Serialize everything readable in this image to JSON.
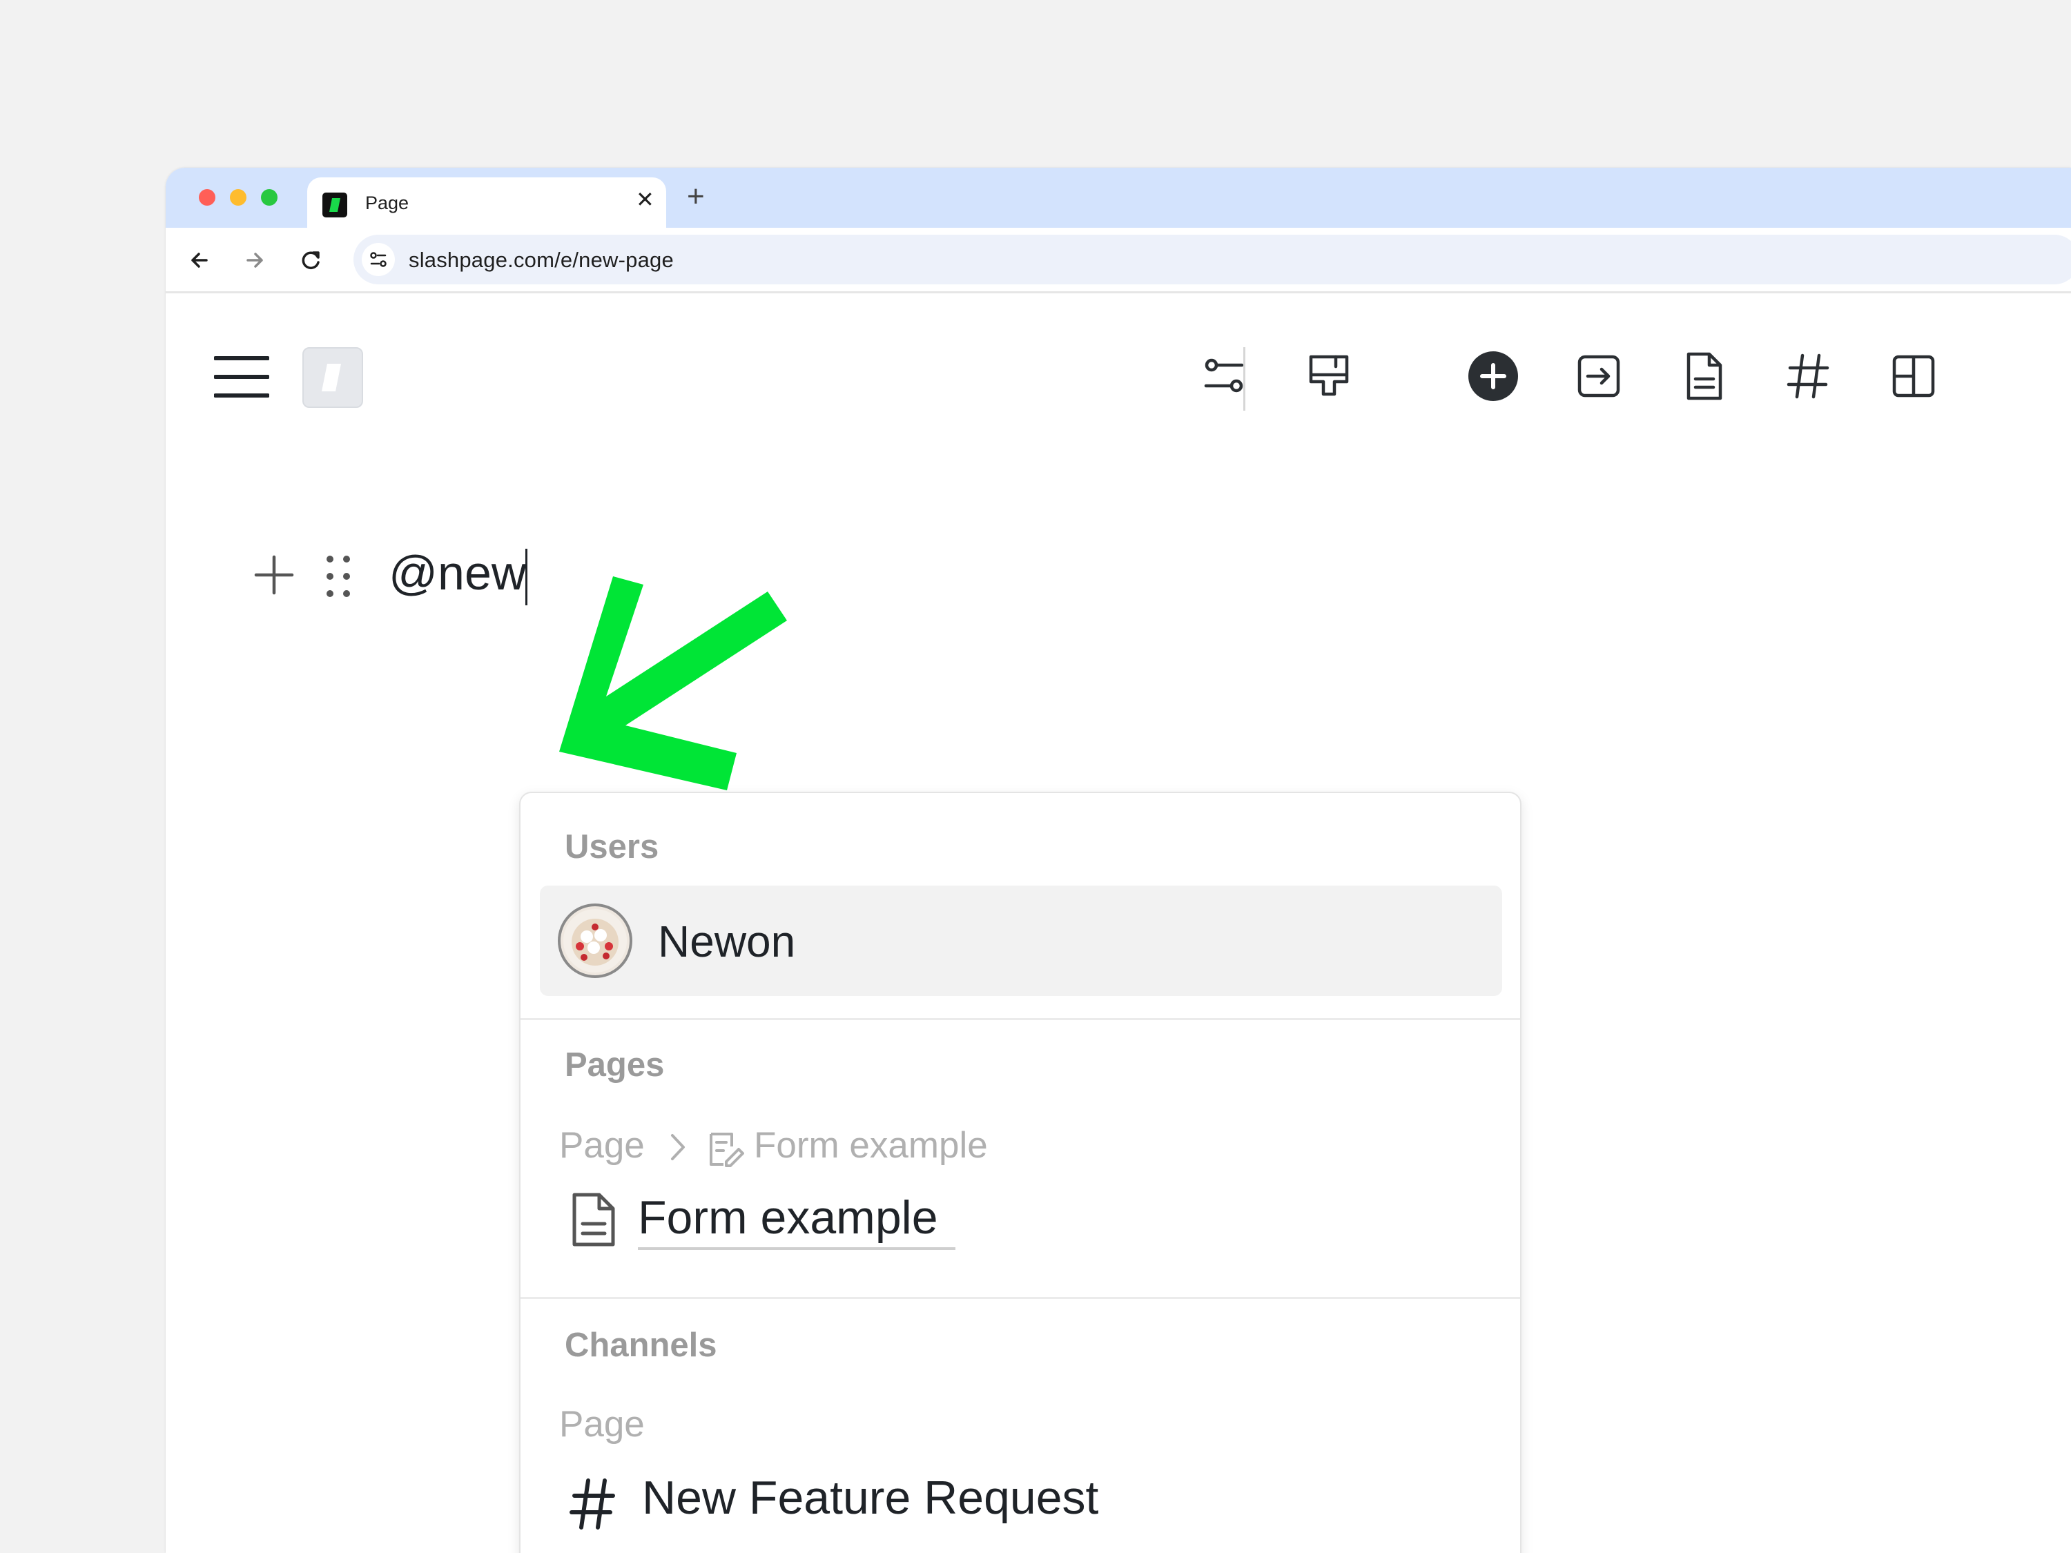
{
  "browser": {
    "tab_title": "Page",
    "tab_close": "✕",
    "new_tab": "+",
    "url": "slashpage.com/e/new-page"
  },
  "editor": {
    "text": "@new"
  },
  "mention_popup": {
    "users_title": "Users",
    "user_name": "Newon",
    "pages_title": "Pages",
    "page_crumb_parent": "Page",
    "page_crumb_child": "Form example",
    "page_item": "Form example",
    "channels_title": "Channels",
    "channel_crumb": "Page",
    "channel_item": "New Feature Request"
  },
  "colors": {
    "tabbar": "#d3e3fd",
    "accent_arrow": "#00e536",
    "text": "#1f2328",
    "muted": "#9a9a9a"
  }
}
